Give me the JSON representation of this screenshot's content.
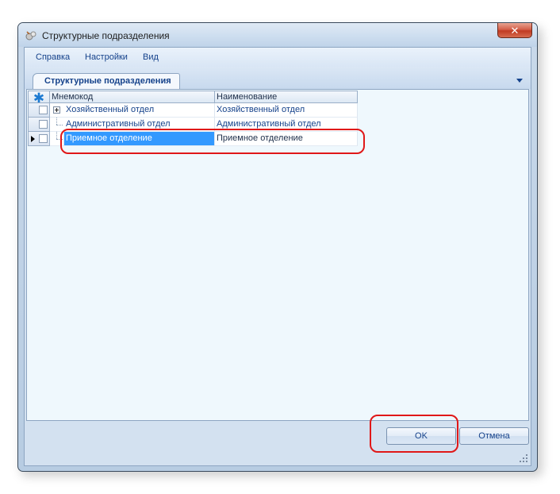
{
  "window": {
    "title": "Структурные подразделения",
    "close_symbol": "✕"
  },
  "menu": [
    {
      "label": "Справка"
    },
    {
      "label": "Настройки"
    },
    {
      "label": "Вид"
    }
  ],
  "tab": {
    "label": "Структурные подразделения",
    "menu_icon": "chevron-down-icon"
  },
  "grid": {
    "header_icon": "asterisk-icon",
    "header_symbol": "✱",
    "columns": [
      "Мнемокод",
      "Наименование"
    ],
    "rows": [
      {
        "code": "Хозяйственный отдел",
        "name": "Хозяйственный отдел",
        "expandable": true,
        "current": false,
        "selected": false
      },
      {
        "code": "Административный отдел",
        "name": "Административный отдел",
        "expandable": false,
        "current": false,
        "selected": false
      },
      {
        "code": "Приемное отделение",
        "name": "Приемное отделение",
        "expandable": false,
        "current": true,
        "selected": true
      }
    ]
  },
  "buttons": {
    "ok": "OK",
    "cancel": "Отмена"
  },
  "colors": {
    "selection": "#3399ff",
    "highlight": "#e01818",
    "accent_text": "#15428b"
  }
}
